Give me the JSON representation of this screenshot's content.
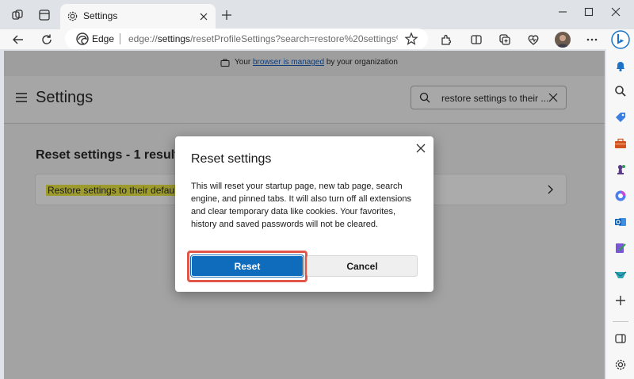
{
  "browser": {
    "tab": {
      "title": "Settings",
      "icon": "gear-icon"
    },
    "omnibox": {
      "label": "Edge",
      "url_domain": "edge://",
      "url_path_strong": "settings",
      "url_rest": "/resetProfileSettings?search=restore%20settings%..."
    },
    "sidebar_icons": [
      "bell-icon",
      "search-icon",
      "tag-icon",
      "toolbox-icon",
      "chess-icon",
      "m365-icon",
      "outlook-icon",
      "drop-icon",
      "games-icon",
      "plus-icon",
      "split-icon",
      "gear-icon"
    ]
  },
  "infobar": {
    "prefix": "Your",
    "link": "browser is managed",
    "suffix": "by your organization"
  },
  "settings": {
    "title": "Settings",
    "search_value": "restore settings to their ...",
    "results_heading": "Reset settings - 1 result",
    "result_item": "Restore settings to their default"
  },
  "dialog": {
    "title": "Reset settings",
    "body": "This will reset your startup page, new tab page, search engine, and pinned tabs. It will also turn off all extensions and clear temporary data like cookies. Your favorites, history and saved passwords will not be cleared.",
    "reset_label": "Reset",
    "cancel_label": "Cancel"
  },
  "colors": {
    "accent": "#0f6cbd",
    "highlight_outline": "#e2564a",
    "search_highlight": "#9d9b2e"
  }
}
